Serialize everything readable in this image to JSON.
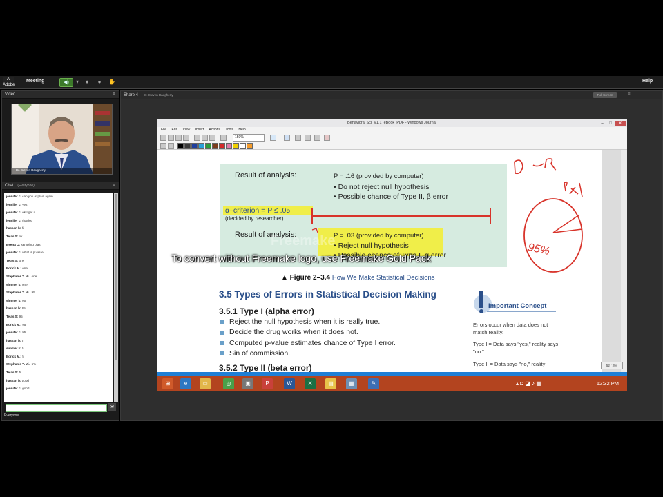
{
  "topbar": {
    "menu_meeting": "Meeting",
    "menu_help": "Help"
  },
  "video_pod": {
    "title": "Video",
    "presenter": "Dr. Steven Daugherty"
  },
  "chat_pod": {
    "title": "Chat",
    "scope": "(Everyone)",
    "messages": [
      {
        "user": "jennifer c:",
        "text": "can you explain again"
      },
      {
        "user": "jennifer c:",
        "text": "yes"
      },
      {
        "user": "jennifer c:",
        "text": "ok I get it"
      },
      {
        "user": "jennifer c:",
        "text": "thanks"
      },
      {
        "user": "hassan b:",
        "text": "hi"
      },
      {
        "user": "Tejas S:",
        "text": "ok"
      },
      {
        "user": "Beena O:",
        "text": "sampling bias"
      },
      {
        "user": "jennifer c:",
        "text": "what is p value"
      },
      {
        "user": "Tejas S:",
        "text": "one"
      },
      {
        "user": "Edrick M.:",
        "text": "one"
      },
      {
        "user": "Stephanie Y. Vi.:",
        "text": "one"
      },
      {
        "user": "simmer k:",
        "text": "one"
      },
      {
        "user": "Stephanie Y. Vi.:",
        "text": "95"
      },
      {
        "user": "simmer k:",
        "text": "95"
      },
      {
        "user": "hassan b:",
        "text": "95"
      },
      {
        "user": "Tejas S:",
        "text": "95"
      },
      {
        "user": "Edrick M.:",
        "text": "95"
      },
      {
        "user": "jennifer c:",
        "text": "95"
      },
      {
        "user": "hassan b:",
        "text": "5"
      },
      {
        "user": "simmer k:",
        "text": "5"
      },
      {
        "user": "Edrick M.:",
        "text": "5"
      },
      {
        "user": "Stephanie Y. Vi.:",
        "text": "5%"
      },
      {
        "user": "Tejas S:",
        "text": "5"
      },
      {
        "user": "hassan b:",
        "text": "good"
      },
      {
        "user": "jennifer c:",
        "text": "good"
      }
    ],
    "footer": "Everyone"
  },
  "share_pod": {
    "title": "Share 4",
    "subtitle": "Dr. Steven Daugherty",
    "fullscreen_label": "Full Screen"
  },
  "journal": {
    "window_title": "Behavioral Sci_V1.1_eBook_PDF - Windows Journal",
    "menus": [
      "File",
      "Edit",
      "View",
      "Insert",
      "Actions",
      "Tools",
      "Help"
    ],
    "zoom": "150%",
    "page_counter": "52 / 294",
    "swatch_colors": [
      "#000000",
      "#3a3a3a",
      "#1f3f9e",
      "#2aa0d8",
      "#2c9c3a",
      "#7a3d1c",
      "#d42a2a",
      "#e07aa8",
      "#f0d000",
      "#ffffff",
      "#f59c2a"
    ]
  },
  "document": {
    "result1_label": "Result of analysis:",
    "result1_p": "P = .16 (provided by computer)",
    "result1_b1": "Do not reject null hypothesis",
    "result1_b2": "Possible chance of Type II, β error",
    "alpha_label": "α–criterion = P ≤ .05",
    "alpha_note": "(decided by researcher)",
    "result2_label": "Result of analysis:",
    "result2_p": "P = .03 (provided by computer)",
    "result2_b1": "Reject null hypothesis",
    "result2_b2": "Possible chance of Type I, α error",
    "figure_label": "▲ Figure 2–3.4",
    "figure_title": "How We Make Statistical Decisions",
    "section_35": "3.5  Types of Errors in Statistical Decision Making",
    "section_351": "3.5.1 Type I (alpha error)",
    "type1_bullets": [
      "Reject the null hypothesis when it is really true.",
      "Decide the drug works when it does not.",
      "Computed p-value estimates chance of Type I error.",
      "Sin of commission."
    ],
    "section_352": "3.5.2 Type II (beta error)",
    "concept_title": "Important Concept",
    "concept_text": "Errors occur when data does not match reality.",
    "concept_t1": "Type I = Data says \"yes,\" reality says \"no.\"",
    "concept_t2": "Type II = Data says \"no,\" reality",
    "ink_dr": "D ⊂ R",
    "ink_p": "P ≤ .05",
    "ink_95": "95%"
  },
  "taskbar": {
    "clock": "12:32 PM"
  },
  "watermark": {
    "brand": "Freemake",
    "text": "To convert without Freemake logo, use Freemake Gold Pack"
  }
}
